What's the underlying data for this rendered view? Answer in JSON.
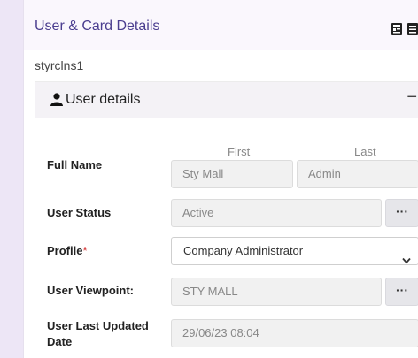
{
  "header": {
    "title": "User & Card Details",
    "icons": [
      "copy-document-icon",
      "list-document-icon"
    ]
  },
  "username": "styrclns1",
  "section": {
    "title": "User details",
    "collapse_symbol": "−",
    "icon": "user-icon"
  },
  "columns": {
    "first": "First",
    "last": "Last"
  },
  "form": {
    "full_name": {
      "label": "Full Name",
      "first": "Sty Mall",
      "last": "Admin"
    },
    "user_status": {
      "label": "User Status",
      "value": "Active",
      "button": "···"
    },
    "profile": {
      "label": "Profile",
      "required_mark": "*",
      "value": "Company Administrator"
    },
    "viewpoint": {
      "label": "User Viewpoint:",
      "value": "STY MALL",
      "button": "···"
    },
    "last_updated": {
      "label": "User Last Updated Date",
      "value": "29/06/23 08:04"
    }
  }
}
